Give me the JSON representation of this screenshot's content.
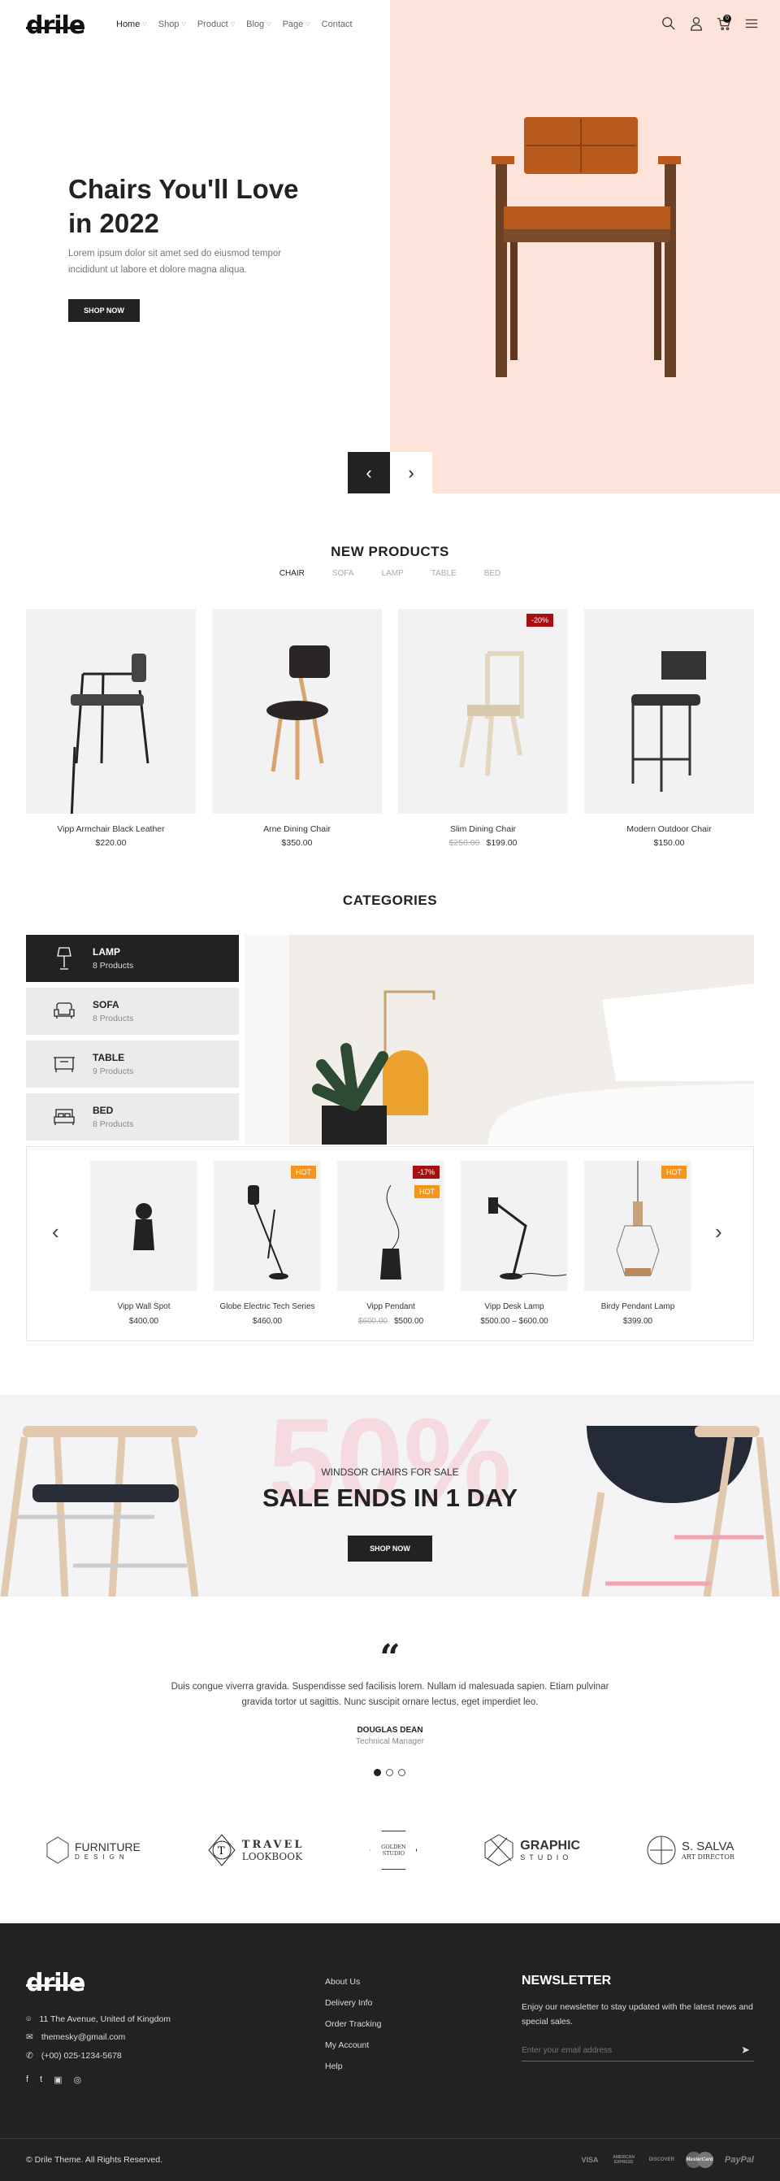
{
  "header": {
    "logo": "drile",
    "nav": [
      {
        "label": "Home",
        "dropdown": true
      },
      {
        "label": "Shop",
        "dropdown": true
      },
      {
        "label": "Product",
        "dropdown": true
      },
      {
        "label": "Blog",
        "dropdown": true
      },
      {
        "label": "Page",
        "dropdown": true
      },
      {
        "label": "Contact",
        "dropdown": false
      }
    ],
    "icons": [
      "search-icon",
      "user-icon",
      "cart-icon",
      "menu-icon"
    ],
    "cart_count": "0"
  },
  "hero": {
    "title_line1": "Chairs You'll Love",
    "title_line2": "in 2022",
    "text": "Lorem ipsum dolor sit amet sed do eiusmod tempor incididunt ut labore et dolore magna aliqua.",
    "button": "SHOP NOW",
    "bg_color": "#fde3da"
  },
  "new_products": {
    "title": "NEW PRODUCTS",
    "tabs": [
      "CHAIR",
      "SOFA",
      "LAMP",
      "TABLE",
      "BED"
    ],
    "active_tab": "CHAIR",
    "items": [
      {
        "name": "Vipp Armchair Black Leather",
        "price": "$220.00"
      },
      {
        "name": "Arne Dining Chair",
        "price": "$350.00"
      },
      {
        "name": "Slim Dining Chair",
        "old_price": "$250.00",
        "price": "$199.00",
        "badge": "-20%"
      },
      {
        "name": "Modern Outdoor Chair",
        "price": "$150.00"
      }
    ]
  },
  "categories": {
    "title": "CATEGORIES",
    "items": [
      {
        "name": "LAMP",
        "count": "8 Products",
        "active": true
      },
      {
        "name": "SOFA",
        "count": "8 Products"
      },
      {
        "name": "TABLE",
        "count": "9 Products"
      },
      {
        "name": "BED",
        "count": "8 Products"
      }
    ],
    "products": [
      {
        "name": "Vipp Wall Spot",
        "price": "$400.00"
      },
      {
        "name": "Globe Electric Tech Series",
        "price": "$460.00",
        "badges": [
          "HOT"
        ]
      },
      {
        "name": "Vipp Pendant",
        "old_price": "$600.00",
        "price": "$500.00",
        "badges": [
          "-17%",
          "HOT"
        ]
      },
      {
        "name": "Vipp Desk Lamp",
        "price": "$500.00 – $600.00"
      },
      {
        "name": "Birdy Pendant Lamp",
        "price": "$399.00",
        "badges": [
          "HOT"
        ]
      }
    ]
  },
  "sale": {
    "big": "50%",
    "subtitle": "WINDSOR CHAIRS FOR SALE",
    "title": "SALE ENDS IN 1 DAY",
    "button": "SHOP NOW"
  },
  "testimonial": {
    "text": "Duis congue viverra gravida. Suspendisse sed facilisis lorem. Nullam id malesuada sapien. Etiam pulvinar gravida tortor ut sagittis. Nunc suscipit ornare lectus, eget imperdiet leo.",
    "name": "DOUGLAS DEAN",
    "role": "Technical Manager",
    "dots": 3,
    "active_dot": 1
  },
  "brands": [
    {
      "l1": "FURNITURE",
      "l2": "DESIGN"
    },
    {
      "l1": "TRAVEL",
      "l2": "LOOKBOOK"
    },
    {
      "l1": "GOLDEN STUDIO",
      "l2": ""
    },
    {
      "l1": "GRAPHIC",
      "l2": "STUDIO"
    },
    {
      "l1": "S. SALVA",
      "l2": "ART DIRECTOR"
    }
  ],
  "footer": {
    "logo": "drile",
    "address": "11 The Avenue, United of Kingdom",
    "email": "themesky@gmail.com",
    "phone": "(+00) 025-1234-5678",
    "socials": [
      "facebook-icon",
      "twitter-icon",
      "flickr-icon",
      "instagram-icon"
    ],
    "links": [
      "About Us",
      "Delivery Info",
      "Order Tracking",
      "My Account",
      "Help"
    ],
    "newsletter_title": "NEWSLETTER",
    "newsletter_text": "Enjoy our newsletter to stay updated with the latest news and special sales.",
    "email_placeholder": "Enter your email address",
    "copyright": "© Drile Theme. All Rights Reserved.",
    "payments": [
      "VISA",
      "AMERICAN EXPRESS",
      "DISCOVER",
      "MasterCard",
      "PayPal"
    ]
  }
}
